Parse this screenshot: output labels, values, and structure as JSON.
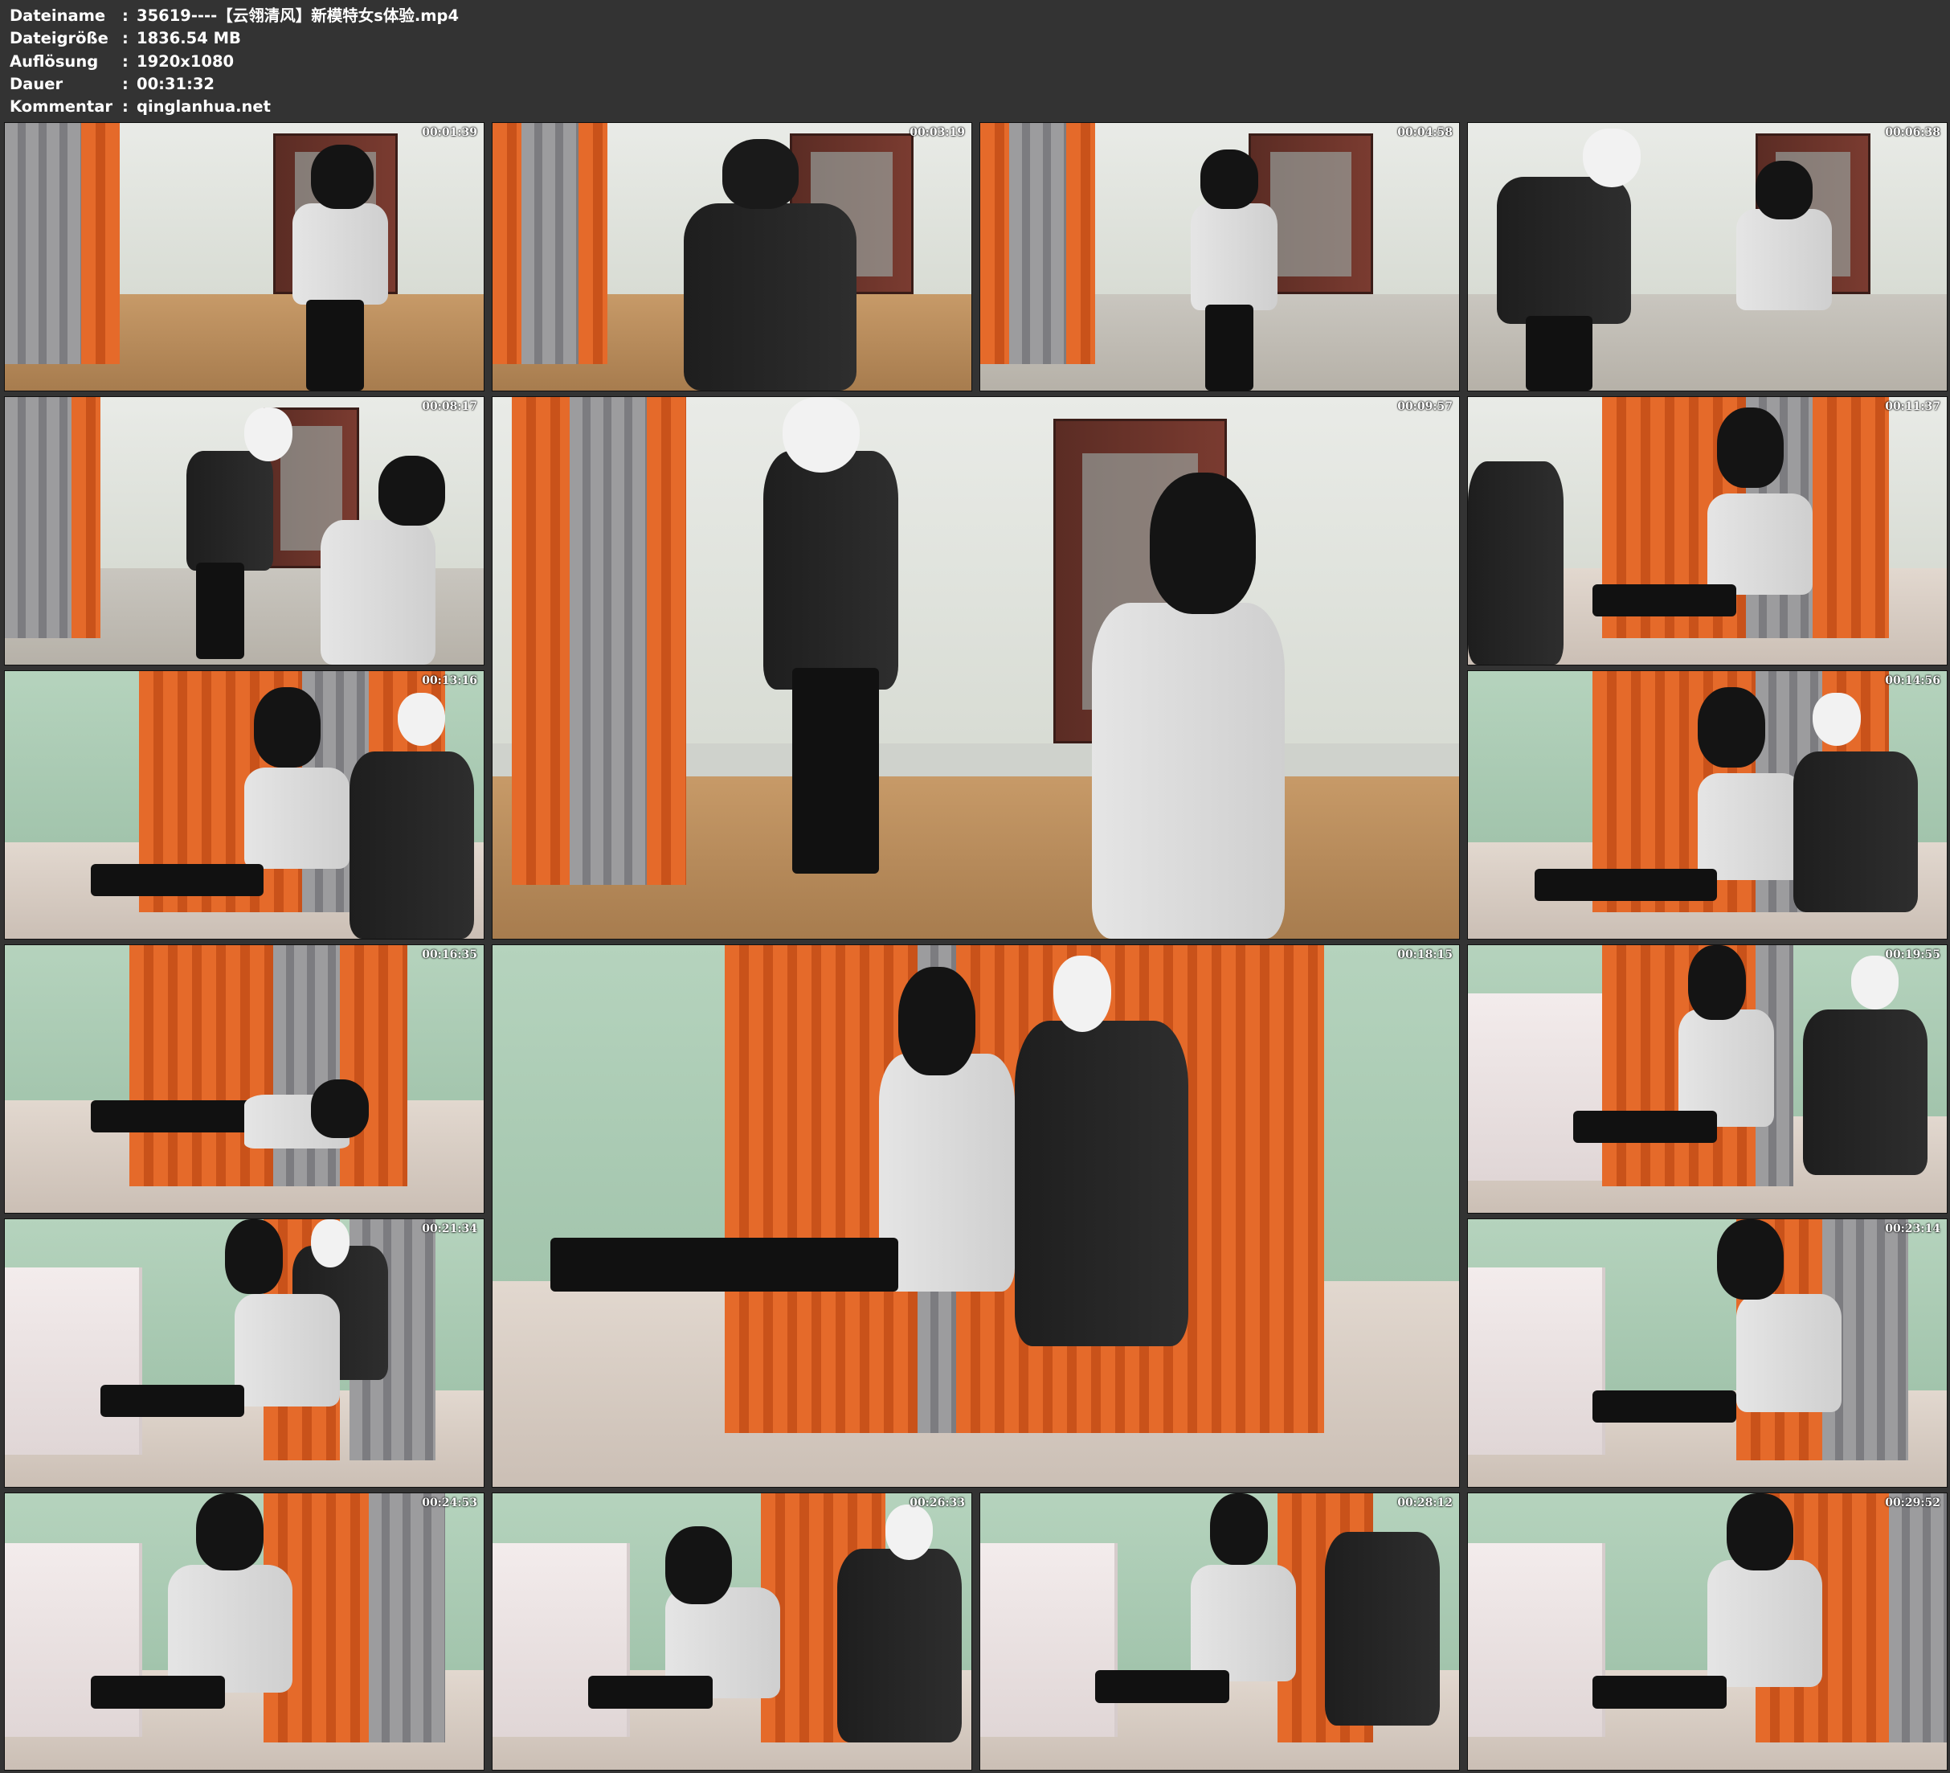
{
  "header": [
    {
      "label": "Dateiname",
      "value": "35619----【云翎清风】新模特女s体验.mp4"
    },
    {
      "label": "Dateigröße",
      "value": "1836.54 MB"
    },
    {
      "label": "Auflösung",
      "value": "1920x1080"
    },
    {
      "label": "Dauer",
      "value": "00:31:32"
    },
    {
      "label": "Kommentar",
      "value": "qinglanhua.net"
    }
  ],
  "separator": ":",
  "thumbnails": [
    {
      "timestamp": "00:01:39"
    },
    {
      "timestamp": "00:03:19"
    },
    {
      "timestamp": "00:04:58"
    },
    {
      "timestamp": "00:06:38"
    },
    {
      "timestamp": "00:08:17"
    },
    {
      "timestamp": "00:09:57"
    },
    {
      "timestamp": "00:11:37"
    },
    {
      "timestamp": "00:13:16"
    },
    {
      "timestamp": "00:14:56"
    },
    {
      "timestamp": "00:16:35"
    },
    {
      "timestamp": "00:18:15"
    },
    {
      "timestamp": "00:19:55"
    },
    {
      "timestamp": "00:21:34"
    },
    {
      "timestamp": "00:23:14"
    },
    {
      "timestamp": "00:24:53"
    },
    {
      "timestamp": "00:26:33"
    },
    {
      "timestamp": "00:28:12"
    },
    {
      "timestamp": "00:29:52"
    }
  ]
}
